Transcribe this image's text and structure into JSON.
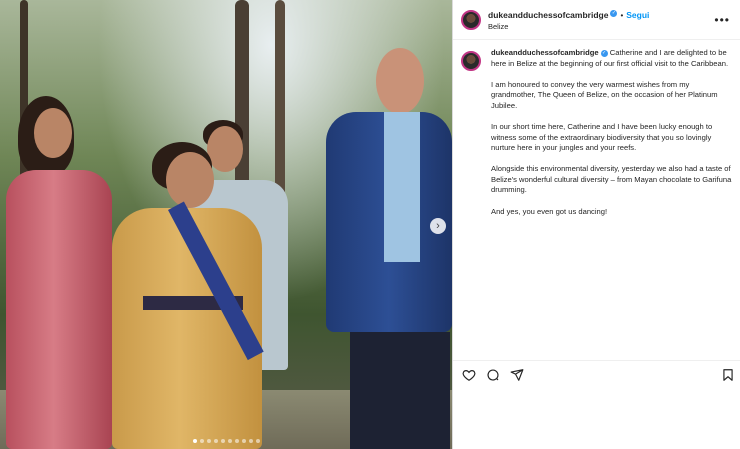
{
  "post": {
    "username": "dukeandduchessofcambridge",
    "separator": "•",
    "follow_label": "Segui",
    "location": "Belize",
    "caption_paragraphs": [
      "Catherine and I are delighted to be here in Belize at the beginning of our first official visit to the Caribbean.",
      "I am honoured to convey the very warmest wishes from my grandmother, The Queen of Belize, on the occasion of her Platinum Jubilee.",
      "In our short time here, Catherine and I have been lucky enough to witness some of the extraordinary biodiversity that you so lovingly nurture here in your jungles and your reefs.",
      "Alongside this environmental diversity, yesterday we also had a taste of Belize's wonderful cultural diversity – from Mayan chocolate to Garifuna drumming.",
      "And yes, you even got us dancing!"
    ]
  },
  "carousel": {
    "total": 10,
    "active_index": 0
  },
  "colors": {
    "follow": "#0095f6",
    "verified": "#3897f0",
    "avatar_ring": "#c13584"
  },
  "icons": {
    "like": "heart-icon",
    "comment": "comment-icon",
    "share": "send-icon",
    "save": "bookmark-icon",
    "more": "more-icon",
    "next": "chevron-right-icon"
  }
}
